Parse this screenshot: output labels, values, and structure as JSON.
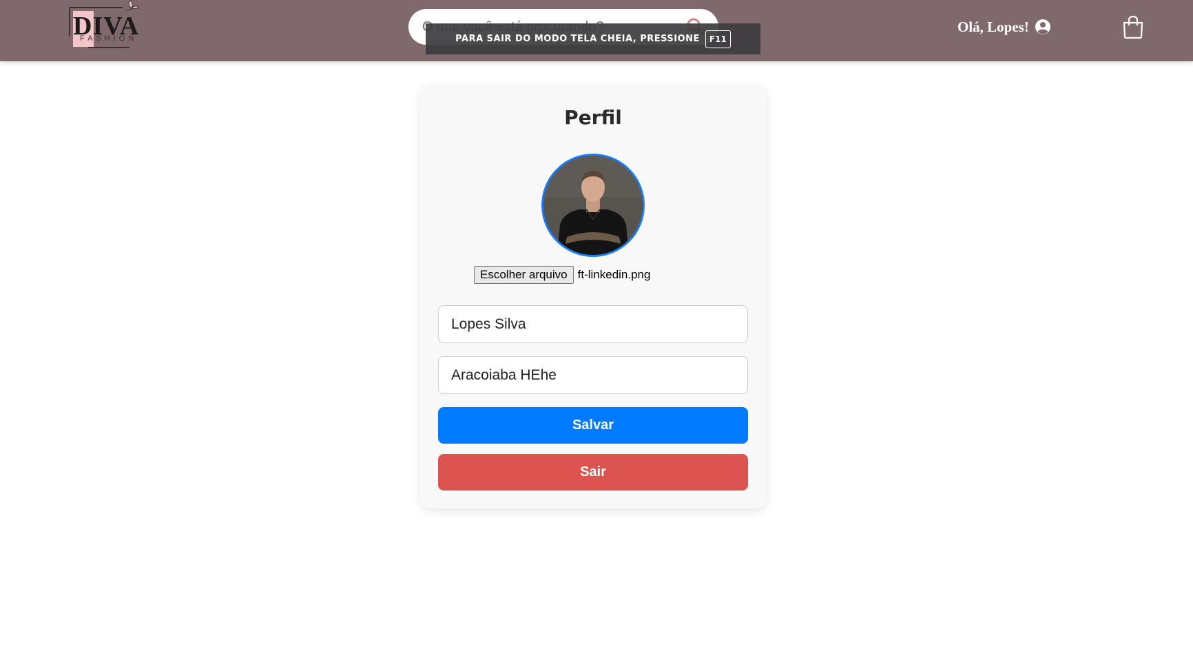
{
  "header": {
    "logo": {
      "wordmark": "DIVA",
      "sub": "FASHION"
    },
    "search": {
      "placeholder": "O que você está procurando?",
      "icon": "search-icon"
    },
    "greeting": "Olá, Lopes!",
    "user_icon": "user-circle-icon",
    "cart_icon": "shopping-bag-icon"
  },
  "fullscreen_notice": {
    "message": "Para sair do modo tela cheia, pressione",
    "key": "F11"
  },
  "profile": {
    "title": "Perfil",
    "file_button": "Escolher arquivo",
    "file_name": "ft-linkedin.png",
    "name_value": "Lopes Silva",
    "address_value": "Aracoiaba HEhe",
    "save_label": "Salvar",
    "logout_label": "Sair"
  },
  "colors": {
    "header_bg": "#80696c",
    "save_button": "#007bff",
    "logout_button": "#dc5350",
    "avatar_border": "#1c7cf4"
  }
}
